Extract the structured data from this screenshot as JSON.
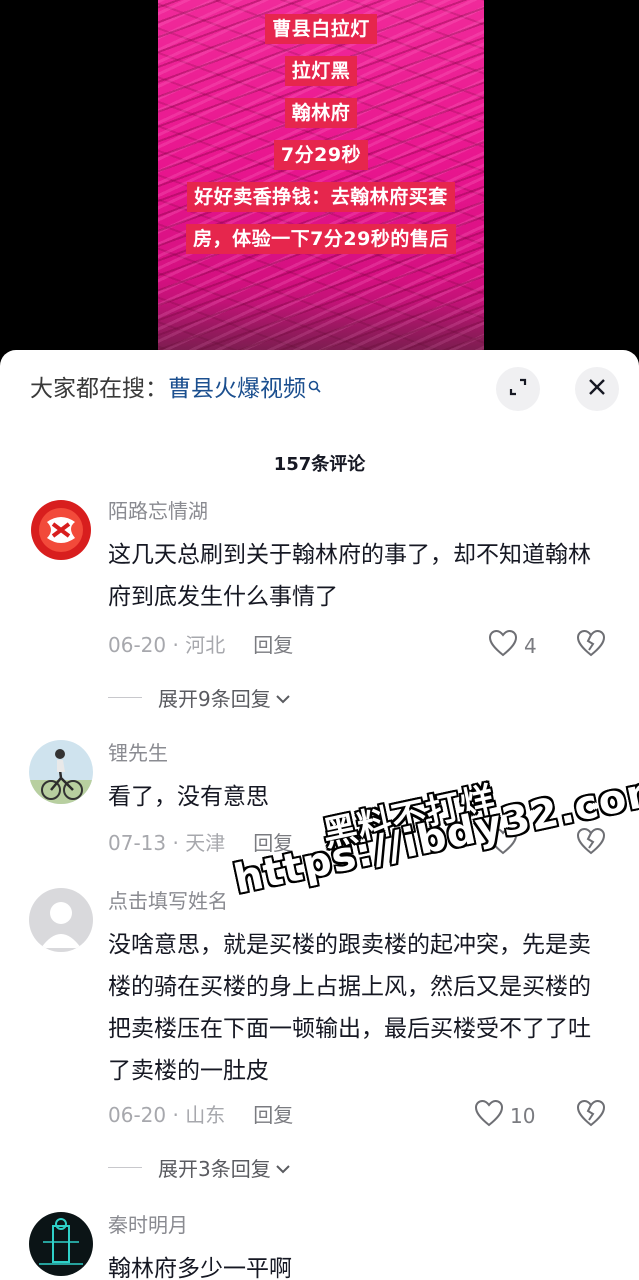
{
  "video": {
    "captions": [
      "曹县白拉灯",
      "拉灯黑",
      "翰林府",
      "7分29秒",
      "好好卖香挣钱：去翰林府买套",
      "房，体验一下7分29秒的售后"
    ],
    "caption_bg": "#e6264d"
  },
  "search_bar": {
    "prefix": "大家都在搜：",
    "term": "曹县火爆视频",
    "term_color": "#1b4f8f",
    "icon": "search-icon"
  },
  "header": {
    "expand_icon": "expand-icon",
    "close_icon": "close-icon",
    "count_title": "157条评论"
  },
  "comments": [
    {
      "name": "陌路忘情湖",
      "text": "这几天总刷到关于翰林府的事了，却不知道翰林府到底发生什么事情了",
      "date": "06-20",
      "location": "河北",
      "reply_label": "回复",
      "likes": "4",
      "expand_label": "展开9条回复"
    },
    {
      "name": "锂先生",
      "text": "看了，没有意思",
      "date": "07-13",
      "location": "天津",
      "reply_label": "回复",
      "likes": ""
    },
    {
      "name": "点击填写姓名",
      "text": "没啥意思，就是买楼的跟卖楼的起冲突，先是卖楼的骑在买楼的身上占据上风，然后又是买楼的把卖楼压在下面一顿输出，最后买楼受不了了吐了卖楼的一肚皮",
      "date": "06-20",
      "location": "山东",
      "reply_label": "回复",
      "likes": "10",
      "expand_label": "展开3条回复"
    },
    {
      "name": "秦时明月",
      "text": "翰林府多少一平啊"
    }
  ],
  "watermark": {
    "line1": "黑料不打烊",
    "line2": "https://ibdy32.com"
  }
}
